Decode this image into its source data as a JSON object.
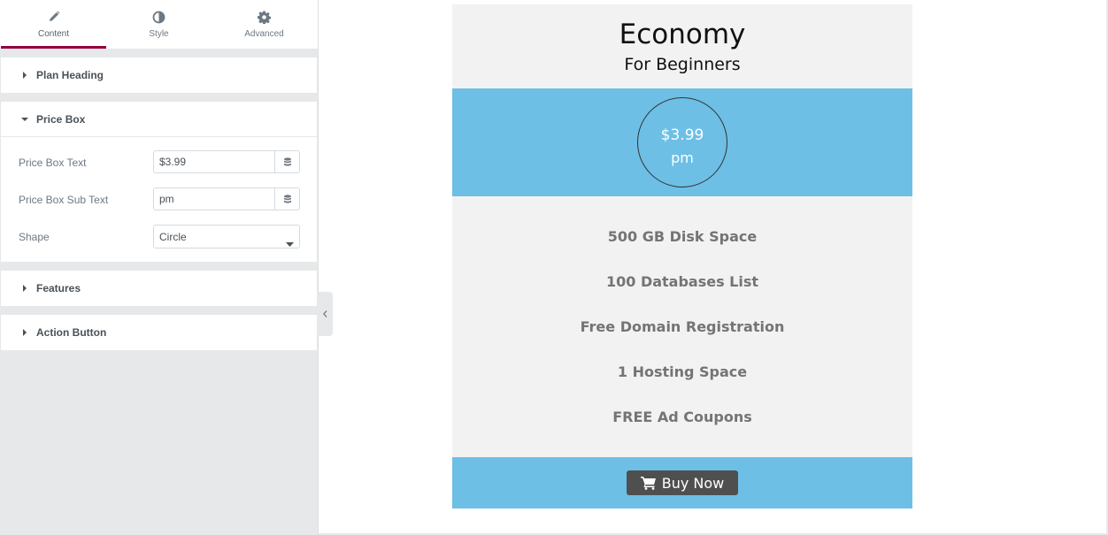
{
  "panel": {
    "tabs": [
      {
        "label": "Content",
        "icon": "pencil-icon"
      },
      {
        "label": "Style",
        "icon": "half-circle-icon"
      },
      {
        "label": "Advanced",
        "icon": "gear-icon"
      }
    ],
    "active_tab": "Content",
    "sections": {
      "plan_heading": "Plan Heading",
      "price_box": "Price Box",
      "features": "Features",
      "action_button": "Action Button"
    },
    "price_box_controls": {
      "price_text_label": "Price Box Text",
      "price_text_value": "$3.99",
      "sub_text_label": "Price Box Sub Text",
      "sub_text_value": "pm",
      "shape_label": "Shape",
      "shape_value": "Circle"
    }
  },
  "card": {
    "title": "Economy",
    "subtitle": "For Beginners",
    "price": "$3.99",
    "price_sub": "pm",
    "features": [
      "500 GB Disk Space",
      "100 Databases List",
      "Free Domain Registration",
      "1 Hosting Space",
      "FREE Ad Coupons"
    ],
    "button_label": "Buy Now",
    "button_icon": "cart-icon"
  },
  "colors": {
    "accent": "#93003c",
    "band": "#6dbfe5",
    "card_bg": "#f2f2f2",
    "button_bg": "#4f4f4f",
    "feature_text": "#747474"
  }
}
